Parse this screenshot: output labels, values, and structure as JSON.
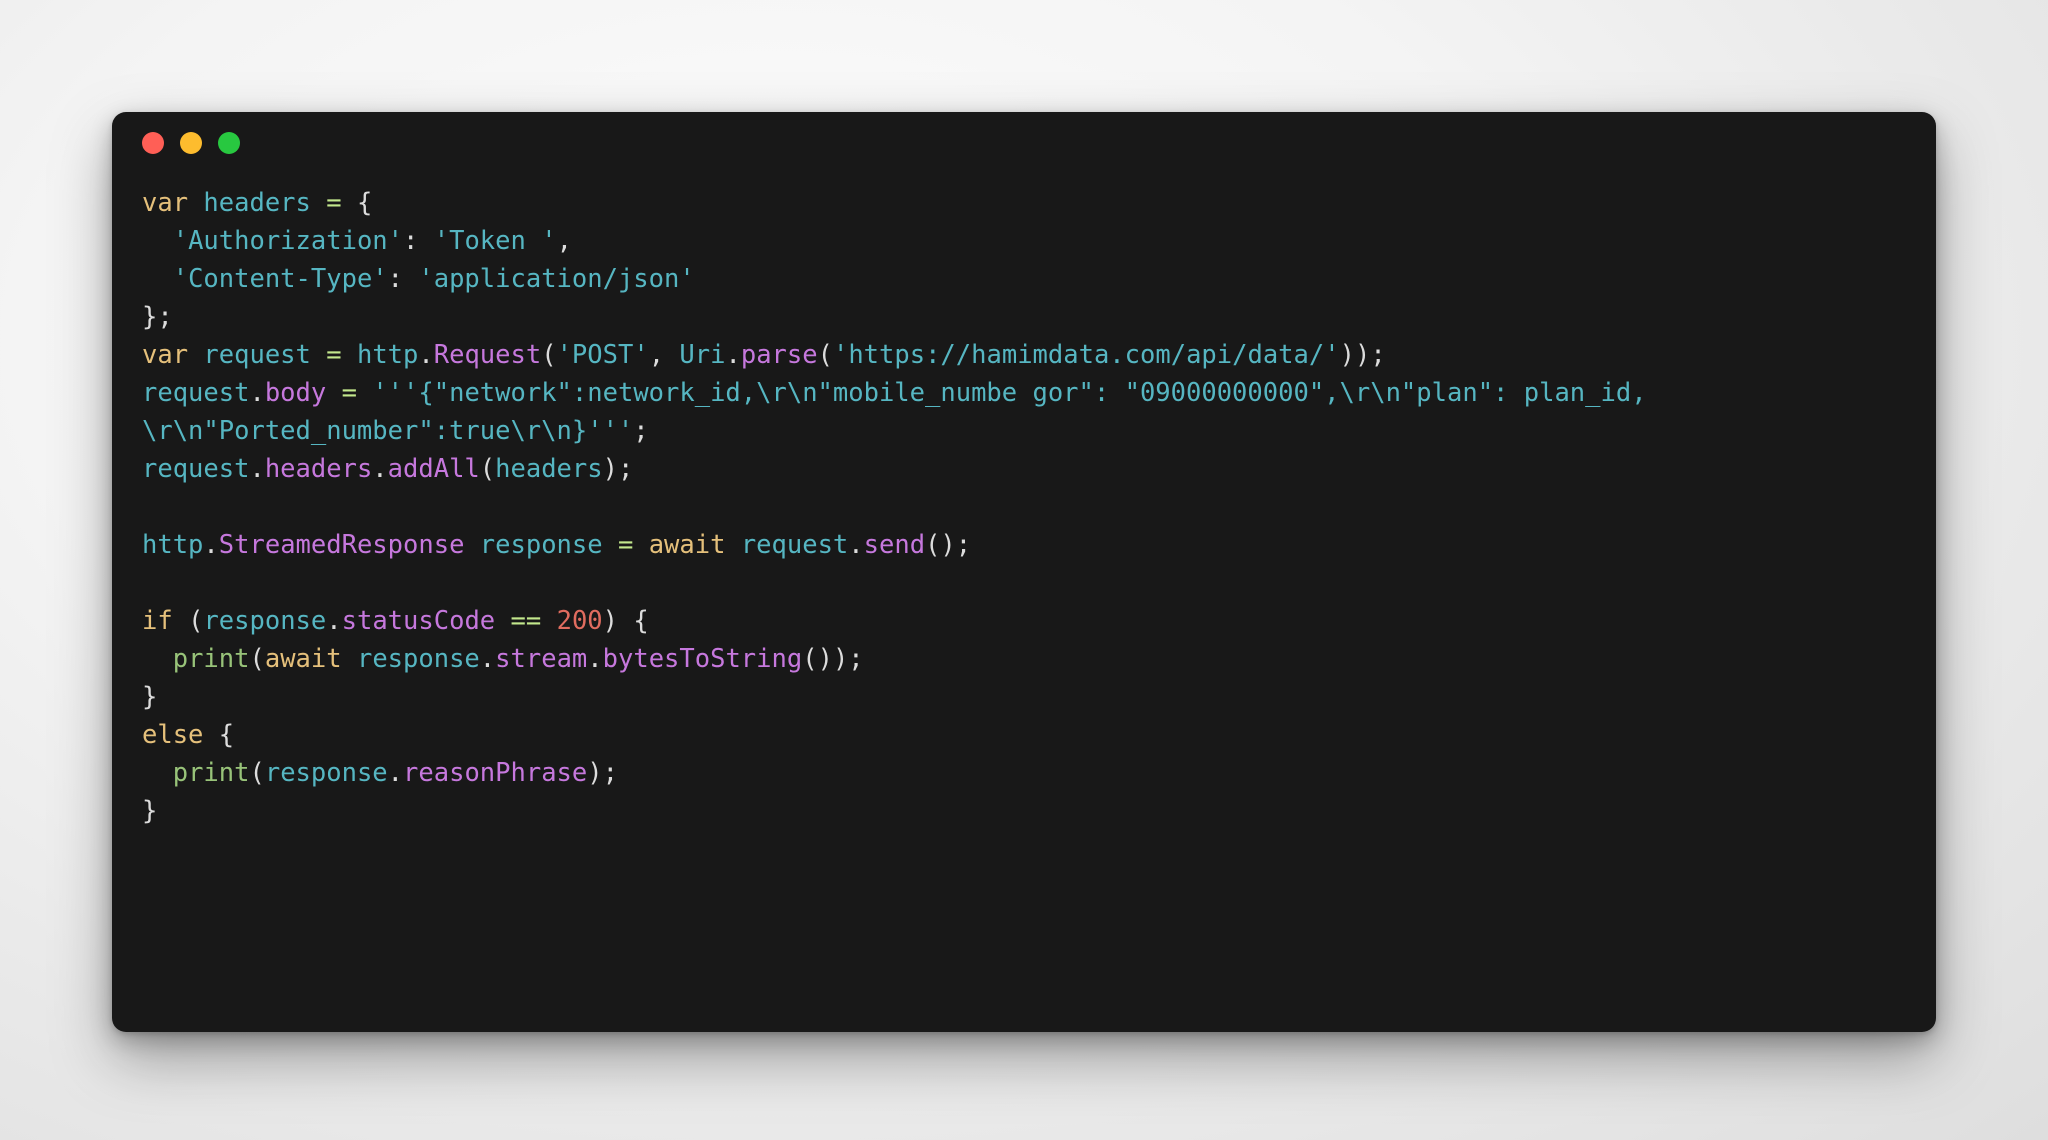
{
  "window": {
    "title": "code-snippet",
    "controls": [
      {
        "name": "close",
        "color": "#ff5f56"
      },
      {
        "name": "minimize",
        "color": "#fdbc2e"
      },
      {
        "name": "maximize",
        "color": "#28c840"
      }
    ]
  },
  "code": {
    "language": "dart",
    "lines": [
      {
        "tokens": [
          {
            "text": "var",
            "type": "kw"
          },
          {
            "text": " ",
            "type": "plain"
          },
          {
            "text": "headers",
            "type": "var"
          },
          {
            "text": " ",
            "type": "plain"
          },
          {
            "text": "=",
            "type": "op"
          },
          {
            "text": " ",
            "type": "plain"
          },
          {
            "text": "{",
            "type": "punct"
          }
        ]
      },
      {
        "tokens": [
          {
            "text": "  ",
            "type": "plain"
          },
          {
            "text": "'Authorization'",
            "type": "str"
          },
          {
            "text": ": ",
            "type": "punct"
          },
          {
            "text": "'Token '",
            "type": "str"
          },
          {
            "text": ",",
            "type": "punct"
          }
        ]
      },
      {
        "tokens": [
          {
            "text": "  ",
            "type": "plain"
          },
          {
            "text": "'Content-Type'",
            "type": "str"
          },
          {
            "text": ": ",
            "type": "punct"
          },
          {
            "text": "'application/json'",
            "type": "str"
          }
        ]
      },
      {
        "tokens": [
          {
            "text": "};",
            "type": "punct"
          }
        ]
      },
      {
        "tokens": [
          {
            "text": "var",
            "type": "kw"
          },
          {
            "text": " ",
            "type": "plain"
          },
          {
            "text": "request",
            "type": "var"
          },
          {
            "text": " ",
            "type": "plain"
          },
          {
            "text": "=",
            "type": "op"
          },
          {
            "text": " ",
            "type": "plain"
          },
          {
            "text": "http",
            "type": "ident"
          },
          {
            "text": ".",
            "type": "punct"
          },
          {
            "text": "Request",
            "type": "prop"
          },
          {
            "text": "(",
            "type": "punct"
          },
          {
            "text": "'POST'",
            "type": "str"
          },
          {
            "text": ", ",
            "type": "punct"
          },
          {
            "text": "Uri",
            "type": "ident"
          },
          {
            "text": ".",
            "type": "punct"
          },
          {
            "text": "parse",
            "type": "prop"
          },
          {
            "text": "(",
            "type": "punct"
          },
          {
            "text": "'https://hamimdata.com/api/data/'",
            "type": "str"
          },
          {
            "text": "));",
            "type": "punct"
          }
        ]
      },
      {
        "tokens": [
          {
            "text": "request",
            "type": "ident"
          },
          {
            "text": ".",
            "type": "punct"
          },
          {
            "text": "body",
            "type": "prop"
          },
          {
            "text": " ",
            "type": "plain"
          },
          {
            "text": "=",
            "type": "op"
          },
          {
            "text": " ",
            "type": "plain"
          },
          {
            "text": "'''{\"network\":network_id,\\r\\n\"mobile_numbe gor\": \"09000000000\",\\r\\n\"plan\": plan_id,",
            "type": "str"
          }
        ]
      },
      {
        "tokens": [
          {
            "text": "\\r\\n\"Ported_number\":true\\r\\n}'''",
            "type": "str"
          },
          {
            "text": ";",
            "type": "punct"
          }
        ]
      },
      {
        "tokens": [
          {
            "text": "request",
            "type": "ident"
          },
          {
            "text": ".",
            "type": "punct"
          },
          {
            "text": "headers",
            "type": "prop"
          },
          {
            "text": ".",
            "type": "punct"
          },
          {
            "text": "addAll",
            "type": "prop"
          },
          {
            "text": "(",
            "type": "punct"
          },
          {
            "text": "headers",
            "type": "ident"
          },
          {
            "text": ");",
            "type": "punct"
          }
        ]
      },
      {
        "tokens": []
      },
      {
        "tokens": [
          {
            "text": "http",
            "type": "ident"
          },
          {
            "text": ".",
            "type": "punct"
          },
          {
            "text": "StreamedResponse",
            "type": "prop"
          },
          {
            "text": " ",
            "type": "plain"
          },
          {
            "text": "response",
            "type": "ident"
          },
          {
            "text": " ",
            "type": "plain"
          },
          {
            "text": "=",
            "type": "op"
          },
          {
            "text": " ",
            "type": "plain"
          },
          {
            "text": "await",
            "type": "kw"
          },
          {
            "text": " ",
            "type": "plain"
          },
          {
            "text": "request",
            "type": "ident"
          },
          {
            "text": ".",
            "type": "punct"
          },
          {
            "text": "send",
            "type": "prop"
          },
          {
            "text": "();",
            "type": "punct"
          }
        ]
      },
      {
        "tokens": []
      },
      {
        "tokens": [
          {
            "text": "if",
            "type": "kw"
          },
          {
            "text": " (",
            "type": "punct"
          },
          {
            "text": "response",
            "type": "ident"
          },
          {
            "text": ".",
            "type": "punct"
          },
          {
            "text": "statusCode",
            "type": "prop"
          },
          {
            "text": " ",
            "type": "plain"
          },
          {
            "text": "==",
            "type": "op"
          },
          {
            "text": " ",
            "type": "plain"
          },
          {
            "text": "200",
            "type": "num"
          },
          {
            "text": ") {",
            "type": "punct"
          }
        ]
      },
      {
        "tokens": [
          {
            "text": "  ",
            "type": "plain"
          },
          {
            "text": "print",
            "type": "fn"
          },
          {
            "text": "(",
            "type": "punct"
          },
          {
            "text": "await",
            "type": "kw"
          },
          {
            "text": " ",
            "type": "plain"
          },
          {
            "text": "response",
            "type": "ident"
          },
          {
            "text": ".",
            "type": "punct"
          },
          {
            "text": "stream",
            "type": "prop"
          },
          {
            "text": ".",
            "type": "punct"
          },
          {
            "text": "bytesToString",
            "type": "prop"
          },
          {
            "text": "());",
            "type": "punct"
          }
        ]
      },
      {
        "tokens": [
          {
            "text": "}",
            "type": "punct"
          }
        ]
      },
      {
        "tokens": [
          {
            "text": "else",
            "type": "kw"
          },
          {
            "text": " {",
            "type": "punct"
          }
        ]
      },
      {
        "tokens": [
          {
            "text": "  ",
            "type": "plain"
          },
          {
            "text": "print",
            "type": "fn"
          },
          {
            "text": "(",
            "type": "punct"
          },
          {
            "text": "response",
            "type": "ident"
          },
          {
            "text": ".",
            "type": "punct"
          },
          {
            "text": "reasonPhrase",
            "type": "prop"
          },
          {
            "text": ");",
            "type": "punct"
          }
        ]
      },
      {
        "tokens": [
          {
            "text": "}",
            "type": "punct"
          }
        ]
      }
    ]
  }
}
